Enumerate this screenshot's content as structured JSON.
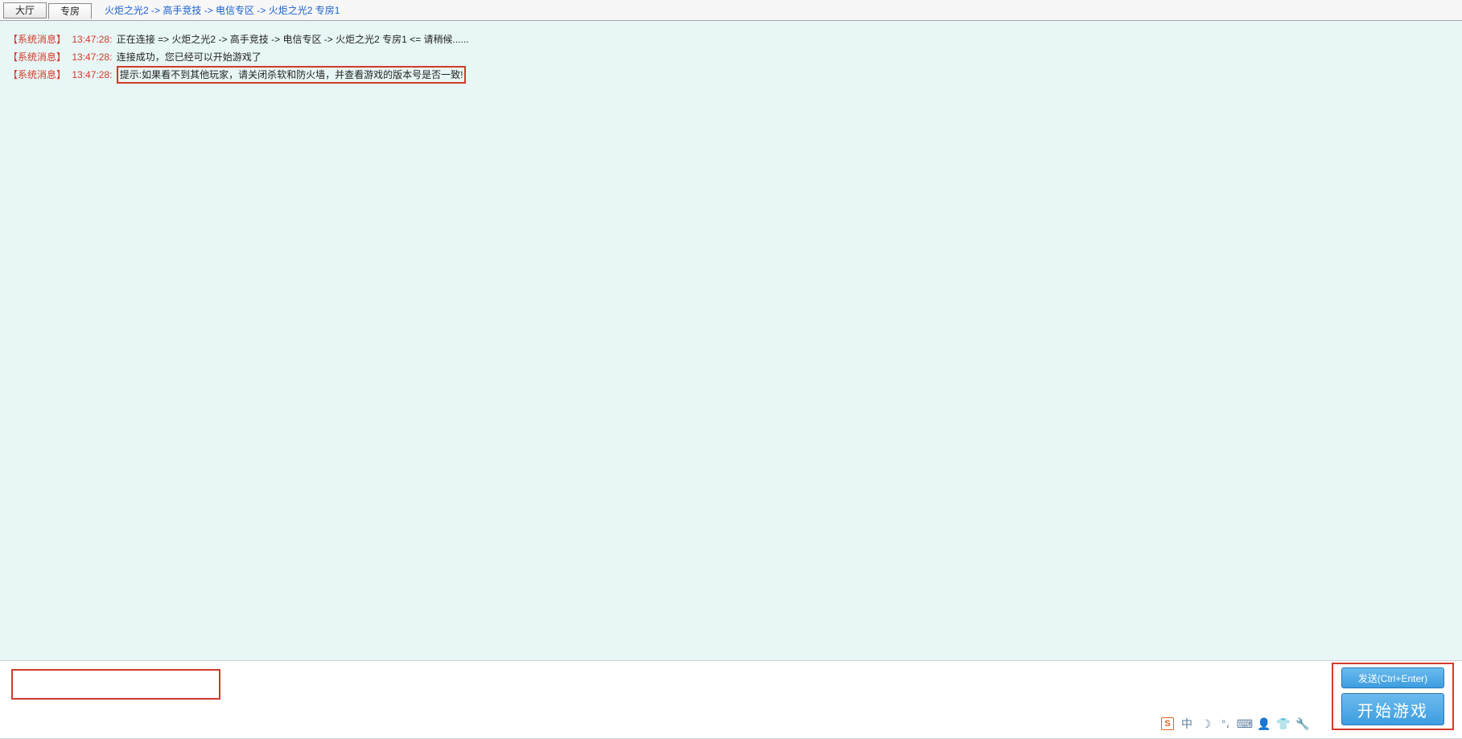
{
  "tabs": {
    "lobby": "大厅",
    "room": "专房"
  },
  "breadcrumb": "火炬之光2 -> 高手竞技 -> 电信专区 -> 火炬之光2 专房1",
  "log": [
    {
      "tag": "【系统消息】",
      "time": "13:47:28:",
      "msg": "正在连接 => 火炬之光2 -> 高手竞技 -> 电信专区 -> 火炬之光2 专房1 <= 请稍候......"
    },
    {
      "tag": "【系统消息】",
      "time": "13:47:28:",
      "msg": "连接成功，您已经可以开始游戏了"
    },
    {
      "tag": "【系统消息】",
      "time": "13:47:28:",
      "msg": "提示:如果看不到其他玩家，请关闭杀软和防火墙，并查看游戏的版本号是否一致!"
    }
  ],
  "input": {
    "value": ""
  },
  "buttons": {
    "send": "发送(Ctrl+Enter)",
    "start": "开始游戏"
  },
  "tray": {
    "s": "S",
    "cn": "中",
    "moon": "☽",
    "deg": "°،",
    "kbd": "⌨",
    "person": "👤",
    "shirt": "👕",
    "wrench": "🔧"
  }
}
